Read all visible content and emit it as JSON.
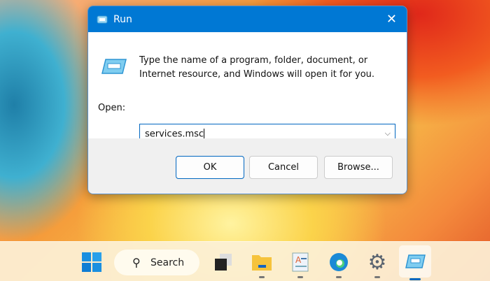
{
  "dialog": {
    "title": "Run",
    "description_line1": "Type the name of a program, folder, document, or",
    "description_line2": "Internet resource, and Windows will open it for you.",
    "open_label": "Open:",
    "open_value": "services.msc",
    "ok": "OK",
    "cancel": "Cancel",
    "browse": "Browse..."
  },
  "taskbar": {
    "search_label": "Search",
    "accent": "#0078d4"
  }
}
